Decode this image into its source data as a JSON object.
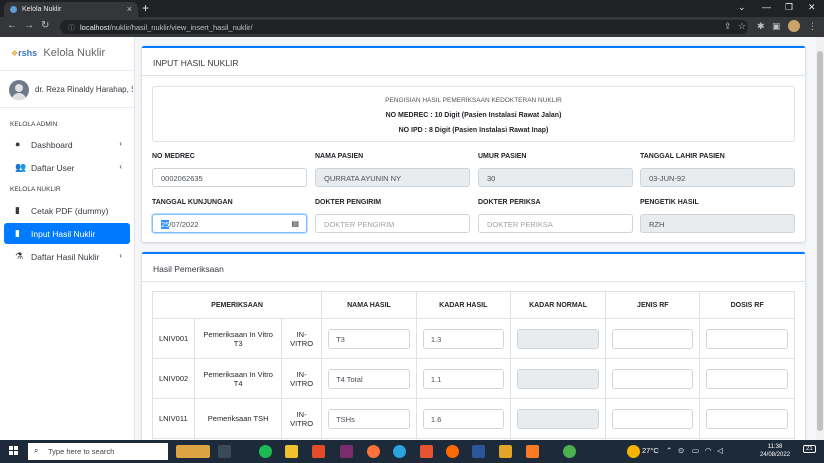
{
  "browser": {
    "tab_title": "Kelola Nuklir",
    "url_host": "localhost",
    "url_path": "/nuklir/hasil_nuklir/view_insert_hasil_nuklir/"
  },
  "sidebar": {
    "brand_logo": "rshs",
    "brand_name": "Kelola Nuklir",
    "user_name": "dr. Reza Rinaldy Harahap, Sp.KN",
    "sections": [
      {
        "header": "KELOLA ADMIN"
      },
      {
        "header": "KELOLA NUKLIR"
      }
    ],
    "items": [
      {
        "label": "Dashboard",
        "icon": "palette-icon"
      },
      {
        "label": "Daftar User",
        "icon": "users-icon"
      },
      {
        "label": "Cetak PDF (dummy)",
        "icon": "file-icon"
      },
      {
        "label": "Input Hasil Nuklir",
        "icon": "file-icon"
      },
      {
        "label": "Daftar Hasil Nuklir",
        "icon": "flask-icon"
      }
    ]
  },
  "form": {
    "card_title": "INPUT HASIL NUKLIR",
    "info_line1": "PENGISIAN HASIL PEMERIKSAAN KEDOKTERAN NUKLIR",
    "info_line2": "NO MEDREC : 10 Digit (Pasien Instalasi Rawat Jalan)",
    "info_line3": "NO IPD : 8 Digit (Pasien Instalasi Rawat Inap)",
    "fields": {
      "no_medrec": {
        "label": "NO MEDREC",
        "value": "0002062635"
      },
      "nama_pasien": {
        "label": "NAMA PASIEN",
        "value": "QURRATA AYUNIN NY"
      },
      "umur_pasien": {
        "label": "UMUR PASIEN",
        "value": "30"
      },
      "tanggal_lahir": {
        "label": "TANGGAL LAHIR PASIEN",
        "value": "03-JUN-92"
      },
      "tanggal_kunjungan": {
        "label": "TANGGAL KUNJUNGAN",
        "value_day": "25",
        "value_rest": "/07/2022"
      },
      "dokter_pengirim": {
        "label": "DOKTER PENGIRIM",
        "placeholder": "DOKTER PENGIRIM"
      },
      "dokter_periksa": {
        "label": "DOKTER PERIKSA",
        "placeholder": "DOKTER PERIKSA"
      },
      "pengetik_hasil": {
        "label": "PENGETIK HASIL",
        "value": "RZH"
      }
    }
  },
  "hasil": {
    "card_title": "Hasil Pemeriksaan",
    "columns": [
      "PEMERIKSAAN",
      "NAMA HASIL",
      "KADAR HASIL",
      "KADAR NORMAL",
      "JENIS RF",
      "DOSIS RF"
    ],
    "rows": [
      {
        "kode": "LNIV001",
        "nama": "Pemeriksaan In Vitro T3",
        "tipe": "IN-VITRO",
        "nama_hasil": "T3",
        "kadar_hasil": "1.3"
      },
      {
        "kode": "LNIV002",
        "nama": "Pemeriksaan In Vitro T4",
        "tipe": "IN-VITRO",
        "nama_hasil": "T4 Total",
        "kadar_hasil": "1.1"
      },
      {
        "kode": "LNIV011",
        "nama": "Pemeriksaan TSH",
        "tipe": "IN-VITRO",
        "nama_hasil": "TSHs",
        "kadar_hasil": "1.6"
      }
    ]
  },
  "taskbar": {
    "search_placeholder": "Type here to search",
    "weather": "27°C",
    "time": "11:38",
    "date": "24/08/2022",
    "notifications": "21"
  }
}
